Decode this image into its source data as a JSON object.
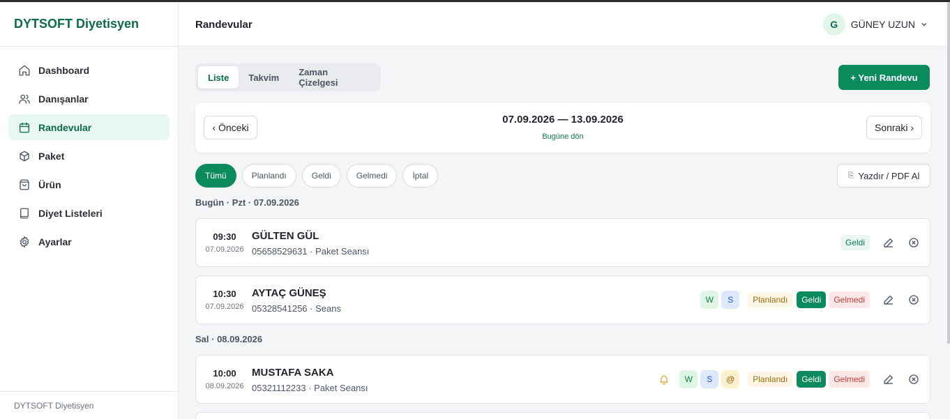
{
  "app": {
    "brand": "DYTSOFT Diyetisyen",
    "footer": "DYTSOFT Diyetisyen"
  },
  "sidebar": {
    "items": [
      {
        "label": "Dashboard",
        "icon": "home-icon",
        "active": false
      },
      {
        "label": "Danışanlar",
        "icon": "users-icon",
        "active": false
      },
      {
        "label": "Randevular",
        "icon": "calendar-icon",
        "active": true
      },
      {
        "label": "Paket",
        "icon": "package-icon",
        "active": false
      },
      {
        "label": "Ürün",
        "icon": "shopping-bag-icon",
        "active": false
      },
      {
        "label": "Diyet Listeleri",
        "icon": "book-icon",
        "active": false
      },
      {
        "label": "Ayarlar",
        "icon": "gear-icon",
        "active": false
      }
    ]
  },
  "header": {
    "title": "Randevular",
    "user_initial": "G",
    "user_name": "GÜNEY UZUN"
  },
  "view_tabs": [
    {
      "label": "Liste",
      "active": true
    },
    {
      "label": "Takvim",
      "active": false
    },
    {
      "label": "Zaman Çizelgesi",
      "active": false
    }
  ],
  "new_button": "+ Yeni Randevu",
  "week": {
    "prev": "‹ Önceki",
    "next": "Sonraki ›",
    "range": "07.09.2026 — 13.09.2026",
    "today_link": "Bugüne dön"
  },
  "filters": [
    {
      "label": "Tümü",
      "active": true
    },
    {
      "label": "Planlandı",
      "active": false
    },
    {
      "label": "Geldi",
      "active": false
    },
    {
      "label": "Gelmedi",
      "active": false
    },
    {
      "label": "İptal",
      "active": false
    }
  ],
  "print_button": "Yazdır / PDF Al",
  "days": [
    {
      "label": "Bugün · Pzt · 07.09.2026",
      "appointments": [
        {
          "time": "09:30",
          "date": "07.09.2026",
          "name": "GÜLTEN GÜL",
          "meta": "05658529631 · Paket Seansı",
          "status_badge": "Geldi"
        },
        {
          "time": "10:30",
          "date": "07.09.2026",
          "name": "AYTAÇ GÜNEŞ",
          "meta": "05328541256 · Seans",
          "channels": [
            "W",
            "S"
          ],
          "status_badge": "Planlandı",
          "mark_present": "Geldi",
          "mark_absent": "Gelmedi"
        }
      ]
    },
    {
      "label": "Sal · 08.09.2026",
      "appointments": [
        {
          "time": "10:00",
          "date": "08.09.2026",
          "name": "MUSTAFA SAKA",
          "meta": "05321112233 · Paket Seansı",
          "reminder_icon": "bell-icon",
          "channels": [
            "W",
            "S",
            "@"
          ],
          "status_badge": "Planlandı",
          "mark_present": "Geldi",
          "mark_absent": "Gelmedi"
        }
      ]
    }
  ],
  "colors": {
    "brand": "#0b6b4a",
    "accent": "#0b8a5c",
    "danger": "#c43b3b",
    "warning": "#9a6a10"
  }
}
